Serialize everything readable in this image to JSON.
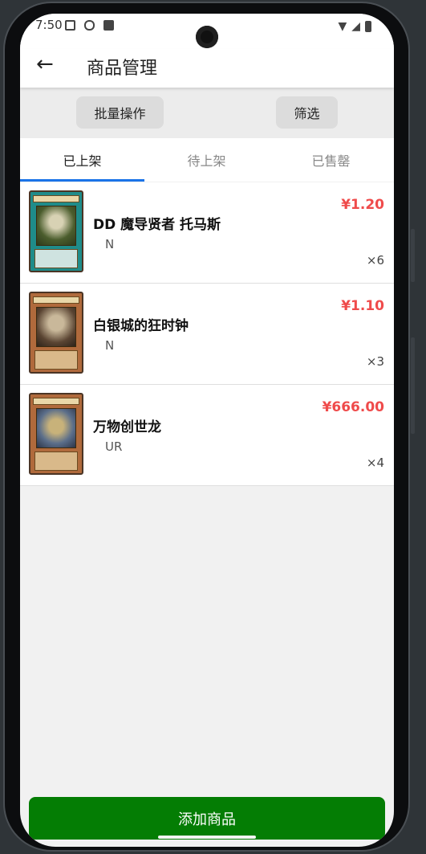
{
  "status_bar": {
    "time": "7:50"
  },
  "app_bar": {
    "title": "商品管理"
  },
  "toolbar": {
    "batch_label": "批量操作",
    "filter_label": "筛选"
  },
  "tabs": [
    {
      "label": "已上架",
      "active": true
    },
    {
      "label": "待上架",
      "active": false
    },
    {
      "label": "已售罄",
      "active": false
    }
  ],
  "products": [
    {
      "name": "DD 魔导贤者 托马斯",
      "rarity": "N",
      "price": "¥1.20",
      "quantity": "×6",
      "card_colors": {
        "frame": "#1f8c8a",
        "art": "#4b5d2d"
      }
    },
    {
      "name": "白银城的狂时钟",
      "rarity": "N",
      "price": "¥1.10",
      "quantity": "×3",
      "card_colors": {
        "frame": "#b06a3c",
        "art": "#5a4432"
      }
    },
    {
      "name": "万物创世龙",
      "rarity": "UR",
      "price": "¥666.00",
      "quantity": "×4",
      "card_colors": {
        "frame": "#b06a3c",
        "art": "#5b6e8a"
      }
    }
  ],
  "footer": {
    "add_label": "添加商品"
  },
  "colors": {
    "accent": "#1a73e8",
    "price": "#ef4b4b",
    "primary_button": "#047d04"
  }
}
